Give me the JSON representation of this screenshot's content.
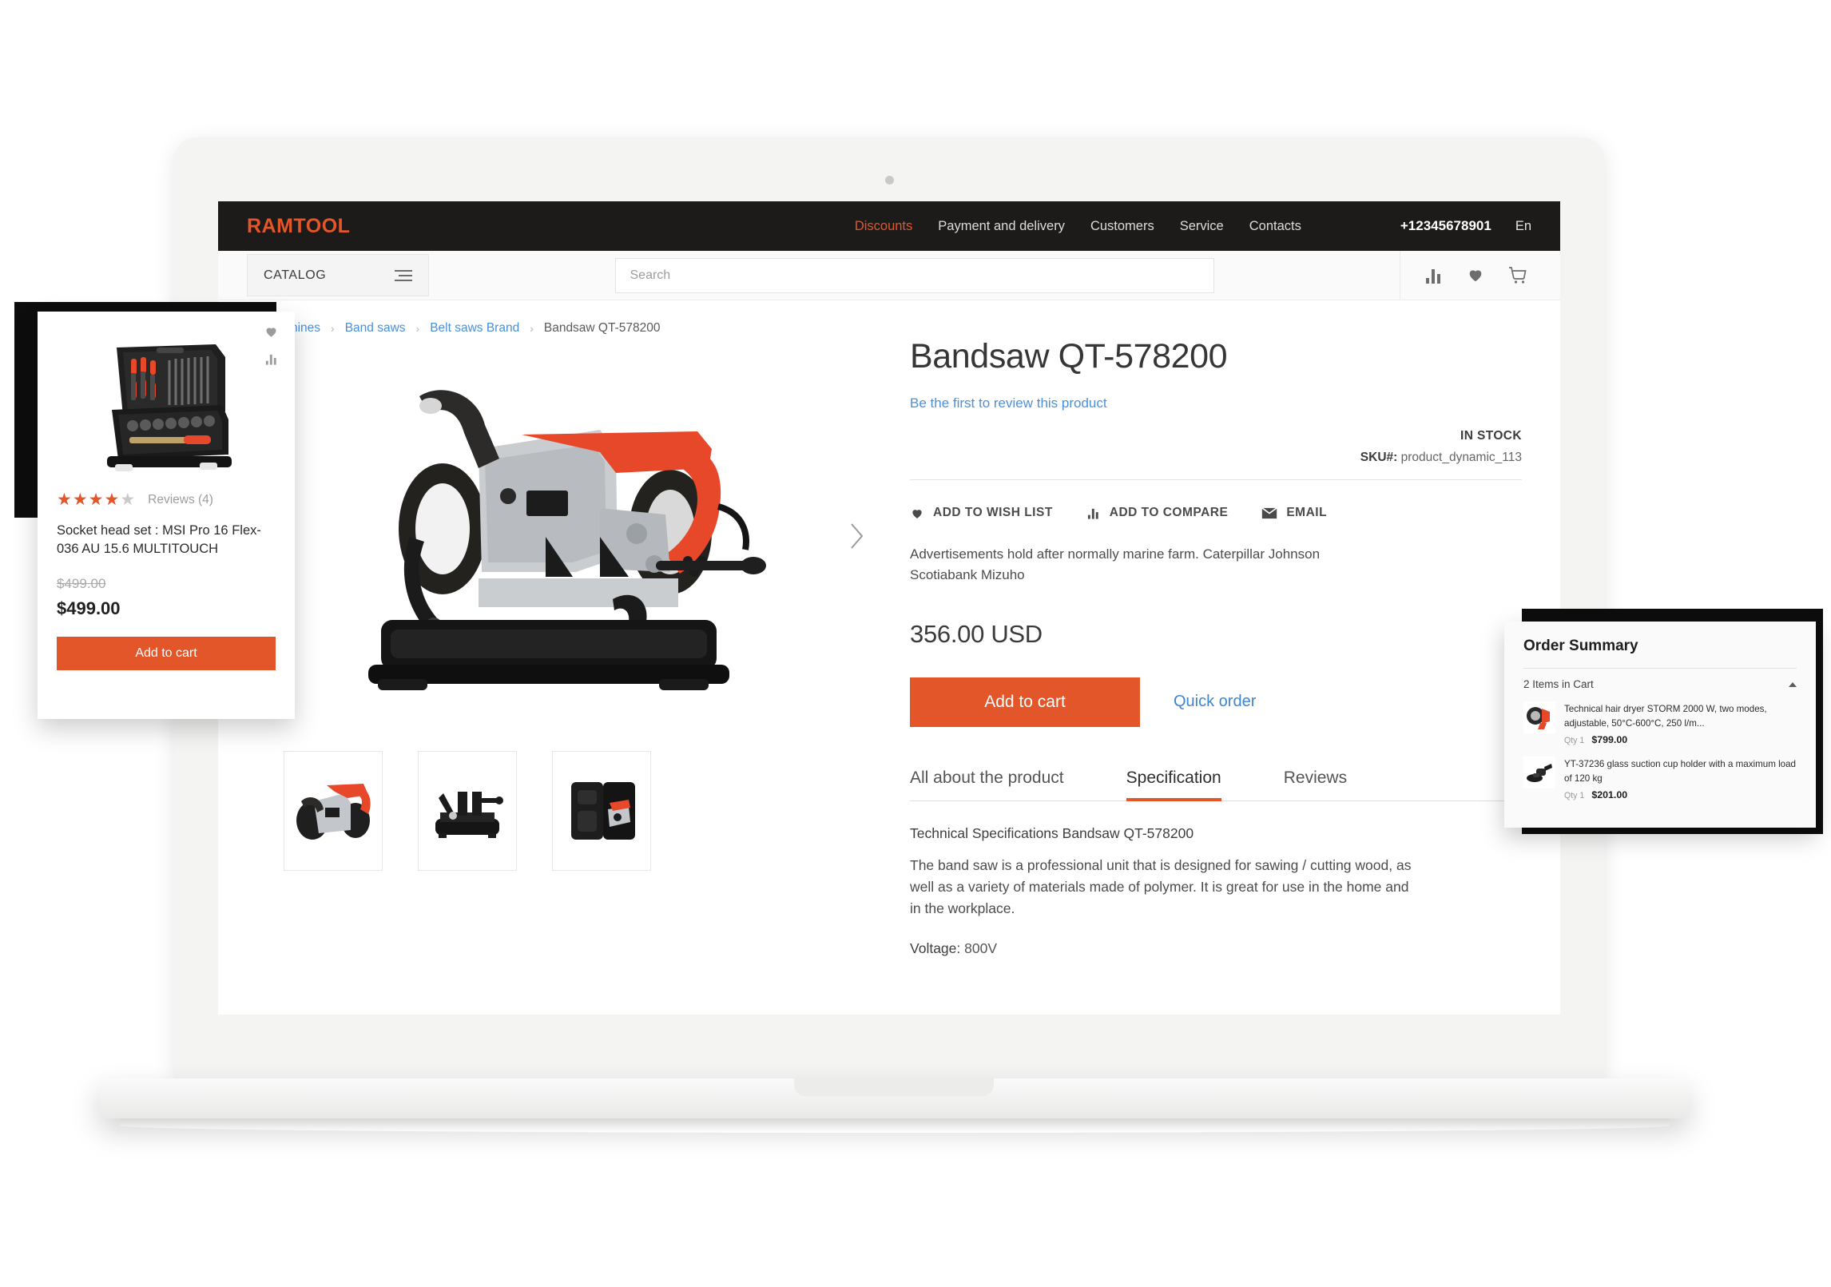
{
  "header": {
    "brand": "RAMTOOL",
    "nav": [
      {
        "label": "Discounts",
        "accent": true
      },
      {
        "label": "Payment and delivery",
        "accent": false
      },
      {
        "label": "Customers",
        "accent": false
      },
      {
        "label": "Service",
        "accent": false
      },
      {
        "label": "Contacts",
        "accent": false
      }
    ],
    "phone": "+12345678901",
    "language": "En"
  },
  "searchbar": {
    "catalog_label": "CATALOG",
    "search_placeholder": "Search",
    "search_value": ""
  },
  "breadcrumb": {
    "items": [
      {
        "label": "Machines",
        "link": true
      },
      {
        "label": "Band saws",
        "link": true
      },
      {
        "label": "Belt saws Brand",
        "link": true
      },
      {
        "label": "Bandsaw QT-578200",
        "link": false
      }
    ]
  },
  "product": {
    "title": "Bandsaw QT-578200",
    "review_link": "Be the first to review this product",
    "stock_status": "IN STOCK",
    "sku_label": "SKU#:",
    "sku_value": "product_dynamic_113",
    "actions": [
      {
        "label": "ADD TO WISH LIST",
        "icon": "heart-icon"
      },
      {
        "label": "ADD TO COMPARE",
        "icon": "compare-icon"
      },
      {
        "label": "EMAIL",
        "icon": "envelope-icon"
      }
    ],
    "short_description": "Advertisements hold after normally marine farm. Caterpillar Johnson Scotiabank Mizuho",
    "price": "356.00 USD",
    "add_to_cart_label": "Add to cart",
    "quick_order_label": "Quick order"
  },
  "tabs": [
    {
      "label": "All about the product",
      "active": false
    },
    {
      "label": "Specification",
      "active": true
    },
    {
      "label": "Reviews",
      "active": false
    }
  ],
  "specification": {
    "heading": "Technical Specifications Bandsaw QT-578200",
    "body": "The band saw is a professional unit that is designed for sawing / cutting wood, as well as a variety of materials made of polymer. It is great for use in the home and in the workplace.",
    "attribute_label": "Voltage:",
    "attribute_value": "800V"
  },
  "product_card": {
    "rating": 4,
    "rating_max": 5,
    "reviews_label": "Reviews (4)",
    "name": "Socket head set : MSI Pro 16 Flex-036 AU 15.6 MULTITOUCH",
    "old_price": "$499.00",
    "price": "$499.00",
    "add_to_cart_label": "Add to cart"
  },
  "order_summary": {
    "title": "Order Summary",
    "items_in_cart": "2 Items in Cart",
    "items": [
      {
        "name": "Technical hair dryer STORM 2000 W, two modes, adjustable, 50°C-600°C, 250 l/m...",
        "qty": "Qty 1",
        "price": "$799.00"
      },
      {
        "name": "YT-37236 glass suction cup holder with a maximum load of 120 kg",
        "qty": "Qty 1",
        "price": "$201.00"
      }
    ]
  },
  "colors": {
    "accent_orange": "#e3562a",
    "link_blue": "#4a90d9",
    "topbar_dark": "#1d1b1a"
  }
}
